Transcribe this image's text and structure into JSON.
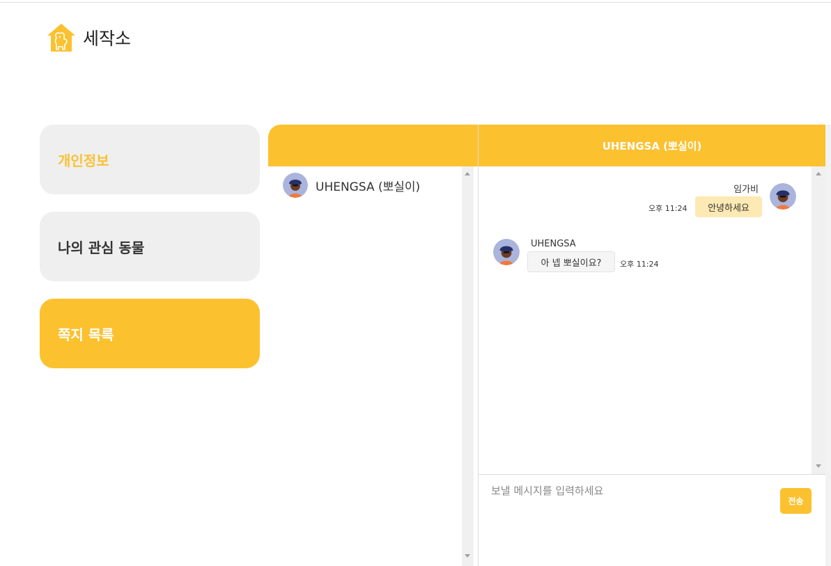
{
  "brand": {
    "name": "세작소",
    "logo_icon": "house-dog-icon",
    "accent_color": "#fbc12f"
  },
  "sidebar": {
    "items": [
      {
        "label": "개인정보",
        "state": "highlighted"
      },
      {
        "label": "나의 관심 동물",
        "state": "default"
      },
      {
        "label": "쪽지 목록",
        "state": "active"
      }
    ]
  },
  "conversation_list": {
    "items": [
      {
        "name": "UHENGSA (뽀실이)",
        "avatar_icon": "avatar-icon"
      }
    ]
  },
  "chat": {
    "title": "UHENGSA (뽀실이)",
    "messages": [
      {
        "sender": "임가비",
        "text": "안녕하세요",
        "time": "오후 11:24",
        "mine": true
      },
      {
        "sender": "UHENGSA",
        "text": "아 넵 뽀실이요?",
        "time": "오후 11:24",
        "mine": false
      }
    ],
    "input": {
      "placeholder": "보낼 메시지를 입력하세요",
      "value": ""
    },
    "send_label": "전송"
  }
}
